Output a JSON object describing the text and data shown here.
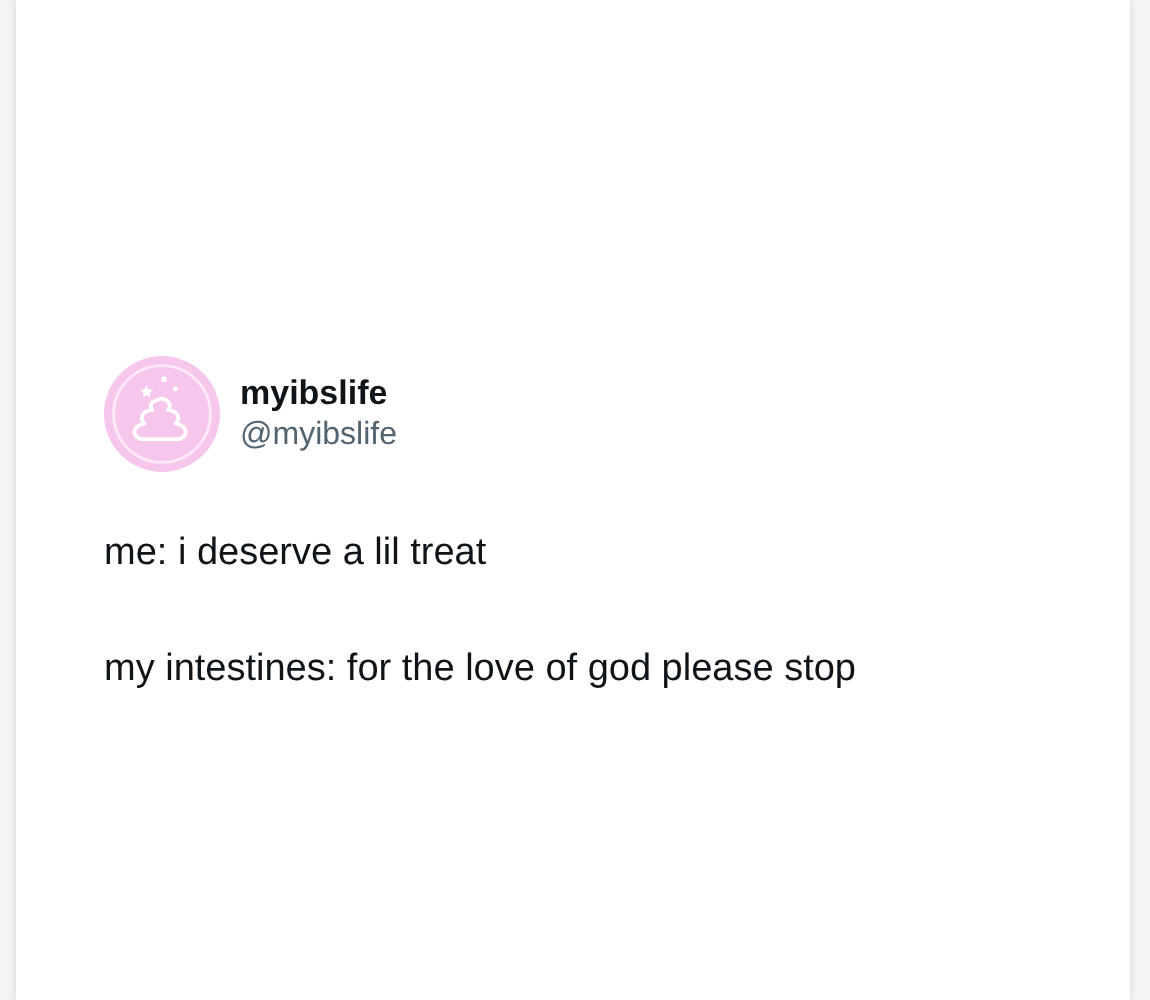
{
  "post": {
    "display_name": "myibslife",
    "handle": "@myibslife",
    "paragraphs": [
      "me: i deserve a lil treat",
      "my intestines: for the love of god please stop"
    ]
  }
}
